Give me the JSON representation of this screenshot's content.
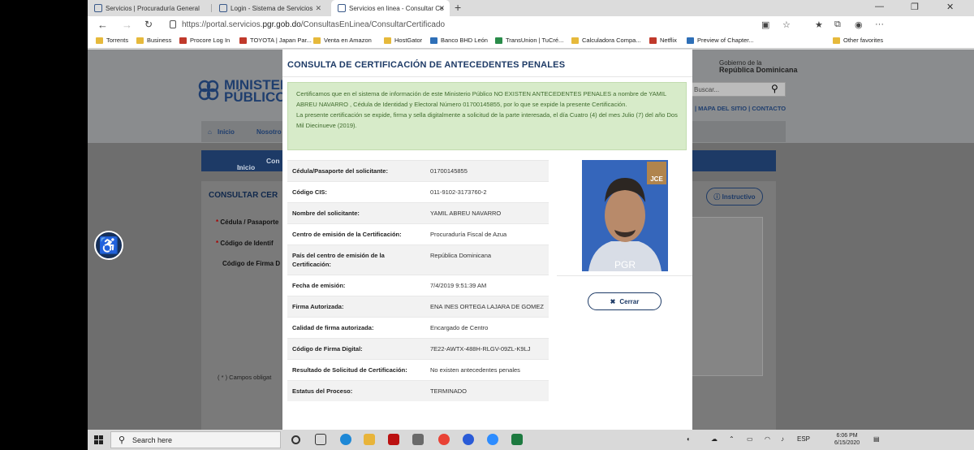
{
  "browser": {
    "tabs": [
      {
        "label": "Servicios | Procuraduría General"
      },
      {
        "label": "Login - Sistema de Servicios"
      },
      {
        "label": "Servicios en linea - Consultar Ce"
      }
    ],
    "url_prefix": "https://portal.servicios.",
    "url_domain": "pgr.gob.do",
    "url_path": "/ConsultasEnLinea/ConsultarCertificado",
    "bookmarks": [
      "Torrents",
      "Business",
      "Procore Log In",
      "TOYOTA | Japan Par...",
      "Venta en Amazon",
      "HostGator",
      "Banco BHD León",
      "TransUnion | TuCré...",
      "Calculadora Compa...",
      "Netflix",
      "Preview of Chapter..."
    ],
    "other_favorites": "Other favorites"
  },
  "site": {
    "logo_line1": "MINISTERIO",
    "logo_line2": "PÚBLICO",
    "gob_line1": "Gobierno de la",
    "gob_line2": "República Dominicana",
    "search_placeholder": "Buscar...",
    "links": "| MAPA DEL SITIO | CONTACTO",
    "nav_home": "Inicio",
    "nav_nosotros": "Nosotro",
    "breadcrumb_home": "Inicio",
    "breadcrumb_next": "Con",
    "panel_title": "CONSULTAR CER",
    "label_cedula": "Cédula / Pasaporte",
    "label_codigo_ident": "Código de Identif",
    "label_firma": "Código de Firma D",
    "footnote": "( * ) Campos obligat",
    "instructivo": "Instructivo"
  },
  "modal": {
    "title": "CONSULTA DE CERTIFICACIÓN DE ANTECEDENTES PENALES",
    "notice_p1": "Certificamos que en el sistema de información de este Ministerio Público NO EXISTEN ANTECEDENTES PENALES a nombre de YAMIL ABREU NAVARRO , Cédula de Identidad y Electoral Número 01700145855, por lo que se expide la presente Certificación.",
    "notice_p2": "La presente certificación se expide, firma y sella digitalmente a solicitud de la parte interesada, el día Cuatro (4) del mes Julio (7) del año Dos Mil Diecinueve (2019).",
    "rows": [
      {
        "label": "Cédula/Pasaporte del solicitante:",
        "value": "01700145855"
      },
      {
        "label": "Código CIS:",
        "value": "011-9102-3173760-2"
      },
      {
        "label": "Nombre del solicitante:",
        "value": "YAMIL ABREU NAVARRO"
      },
      {
        "label": "Centro de emisión de la Certificación:",
        "value": "Procuraduría Fiscal de Azua"
      },
      {
        "label": "País del centro de emisión de la Certificación:",
        "value": "República Dominicana"
      },
      {
        "label": "Fecha de emisión:",
        "value": "7/4/2019 9:51:39 AM"
      },
      {
        "label": "Firma Autorizada:",
        "value": "ENA INES ORTEGA LAJARA DE GOMEZ"
      },
      {
        "label": "Calidad de firma autorizada:",
        "value": "Encargado de Centro"
      },
      {
        "label": "Código de Firma Digital:",
        "value": "7E22-AWTX-488H-RLGV-09ZL-K9LJ"
      },
      {
        "label": "Resultado de Solicitud de Certificación:",
        "value": "No existen antecedentes penales"
      },
      {
        "label": "Estatus del Proceso:",
        "value": "TERMINADO"
      }
    ],
    "photo_watermark": "PGR",
    "photo_logo": "JCE",
    "close_label": "Cerrar"
  },
  "taskbar": {
    "search_placeholder": "Search here",
    "lang": "ESP",
    "time": "6:06 PM",
    "date": "6/15/2020"
  }
}
